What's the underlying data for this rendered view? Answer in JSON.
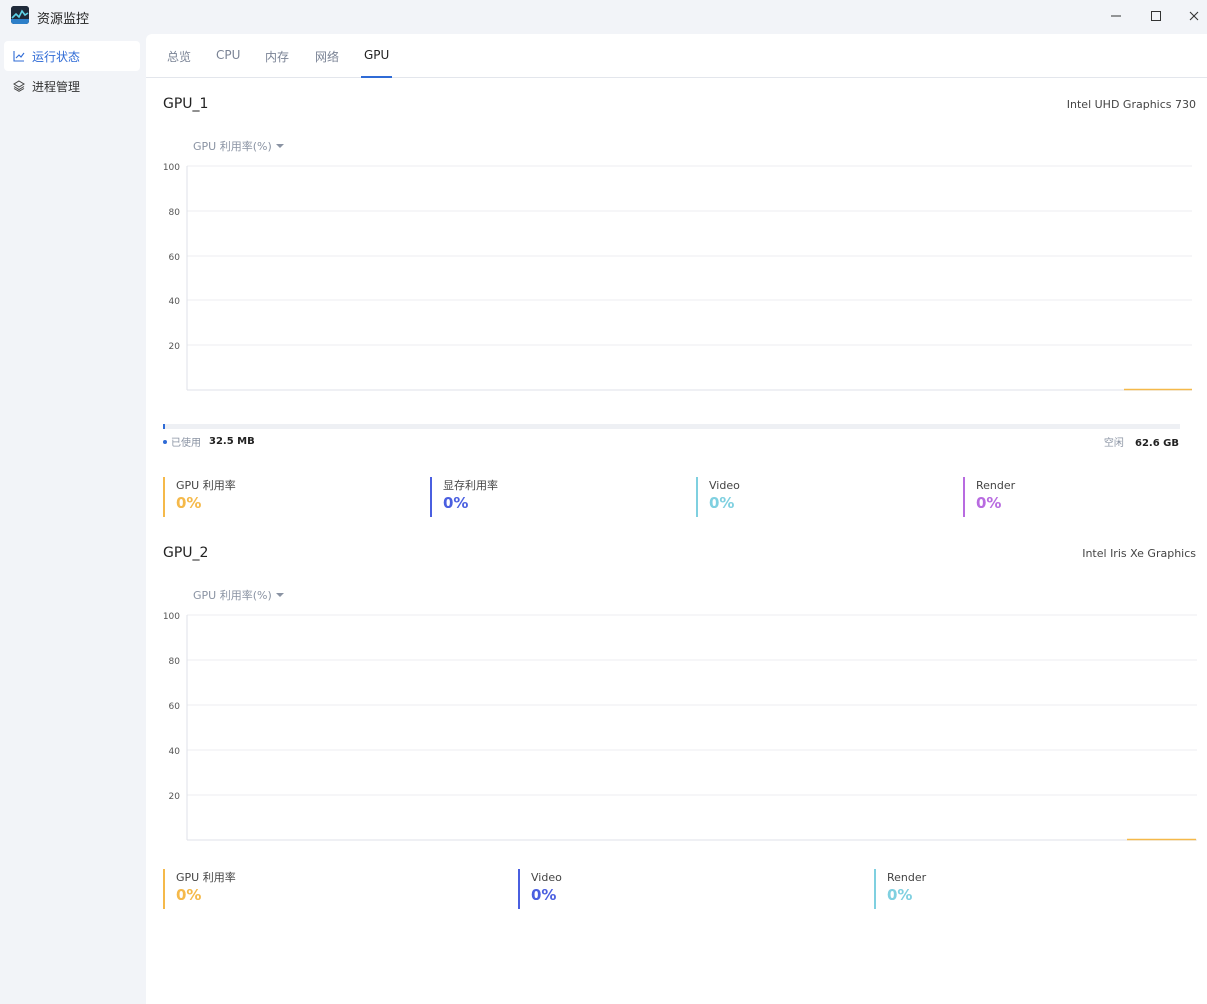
{
  "app": {
    "title": "资源监控"
  },
  "window": {
    "minimize_icon": "minimize-icon",
    "maximize_icon": "maximize-icon",
    "close_icon": "close-icon"
  },
  "sidebar": {
    "items": [
      {
        "label": "运行状态",
        "icon": "line-chart-icon",
        "active": true
      },
      {
        "label": "进程管理",
        "icon": "layers-icon",
        "active": false
      }
    ]
  },
  "tabs": [
    {
      "label": "总览",
      "active": false
    },
    {
      "label": "CPU",
      "active": false
    },
    {
      "label": "内存",
      "active": false
    },
    {
      "label": "网络",
      "active": false
    },
    {
      "label": "GPU",
      "active": true
    }
  ],
  "colors": {
    "accent": "#2f6bd6",
    "gpu_util": "#f5b94a",
    "mem_util": "#4a5fe0",
    "video": "#7fd0e0",
    "render": "#b86be0"
  },
  "gpus": [
    {
      "name": "GPU_1",
      "model": "Intel UHD Graphics 730",
      "metric_select": "GPU 利用率(%)",
      "y_ticks": [
        "100",
        "80",
        "60",
        "40",
        "20"
      ],
      "memory": {
        "used_label": "已使用",
        "used_value": "32.5 MB",
        "free_label": "空闲",
        "free_value": "62.6 GB",
        "used_fraction": 0.0005
      },
      "stats": [
        {
          "label": "GPU 利用率",
          "value": "0%"
        },
        {
          "label": "显存利用率",
          "value": "0%"
        },
        {
          "label": "Video",
          "value": "0%"
        },
        {
          "label": "Render",
          "value": "0%"
        }
      ]
    },
    {
      "name": "GPU_2",
      "model": "Intel Iris Xe Graphics",
      "metric_select": "GPU 利用率(%)",
      "y_ticks": [
        "100",
        "80",
        "60",
        "40",
        "20"
      ],
      "stats": [
        {
          "label": "GPU 利用率",
          "value": "0%"
        },
        {
          "label": "Video",
          "value": "0%"
        },
        {
          "label": "Render",
          "value": "0%"
        }
      ]
    }
  ]
}
